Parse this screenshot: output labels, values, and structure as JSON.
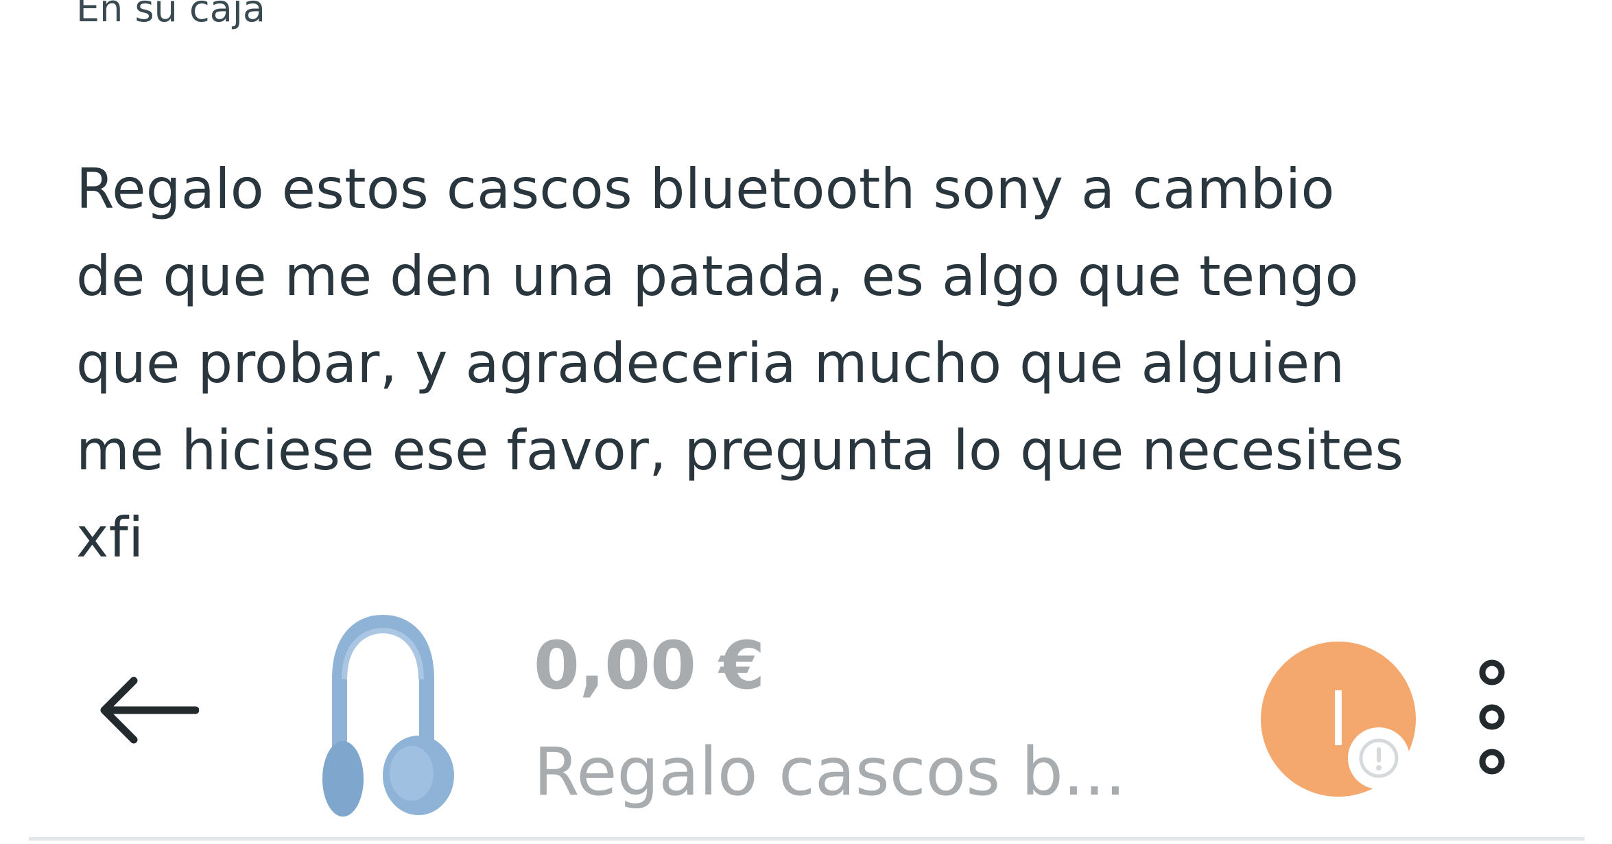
{
  "condition": {
    "label": "En su caja"
  },
  "description": {
    "lines": [
      "Regalo estos cascos bluetooth sony a cambio",
      "de que me den una patada, es algo que tengo",
      "que probar, y agradeceria mucho que alguien",
      "me hiciese ese favor, pregunta lo que necesites",
      "xfi"
    ]
  },
  "bottom_bar": {
    "back_icon": "arrow-left-icon",
    "product_image": "headphones-icon",
    "price": "0,00 €",
    "item_title": "Regalo cascos b...",
    "avatar_letter": "l",
    "avatar_badge_icon": "warning-icon",
    "menu_icon": "more-vertical-icon"
  },
  "colors": {
    "avatar": "#f4a86e",
    "muted_text": "#a8acae",
    "headphones": "#8fb3d6"
  }
}
